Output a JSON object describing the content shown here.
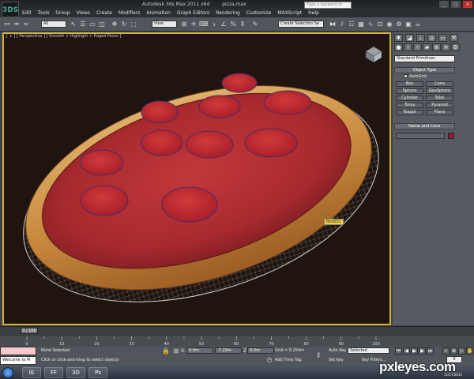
{
  "window": {
    "app_title": "Autodesk 3ds Max 2011 x64",
    "file_name": "pizza.max",
    "search_placeholder": "Type a keyword or phrase",
    "logo": "3DS",
    "controls": [
      "_",
      "□",
      "x"
    ]
  },
  "menu": [
    "Edit",
    "Tools",
    "Group",
    "Views",
    "Create",
    "Modifiers",
    "Animation",
    "Graph Editors",
    "Rendering",
    "Customize",
    "MAXScript",
    "Help"
  ],
  "toolbar": {
    "filter_value": "All",
    "refcoord_value": "View",
    "named_sel_placeholder": "Create Selection Se"
  },
  "viewport": {
    "label": "[ + ] [ Perspective ] [ Smooth + Highlight + Edged Faces ]",
    "object_tag": "Box001"
  },
  "command_panel": {
    "category_value": "Standard Primitives",
    "object_type_title": "Object Type",
    "autogrid_label": "AutoGrid",
    "buttons": [
      "Box",
      "Cone",
      "Sphere",
      "GeoSphere",
      "Cylinder",
      "Tube",
      "Torus",
      "Pyramid",
      "Teapot",
      "Plane"
    ],
    "name_color_title": "Name and Color",
    "object_color": "#9a1a3a"
  },
  "timeline": {
    "slider_label": "0 / 100",
    "ticks": [
      "0",
      "10",
      "20",
      "30",
      "40",
      "50",
      "60",
      "70",
      "80",
      "90",
      "100"
    ],
    "tick_values": [
      0,
      10,
      20,
      30,
      40,
      50,
      60,
      70,
      80,
      90,
      100
    ]
  },
  "status": {
    "maxscript_text": "Welcome to M",
    "selection_status": "None Selected",
    "prompt": "Click or click-and-drag to select objects",
    "x_label": "X:",
    "x_value": "0.0m",
    "y_label": "Y:",
    "y_value": "-7.22m",
    "z_label": "Z:",
    "z_value": "0.0m",
    "grid": "Grid = 0.254m",
    "add_time_tag": "Add Time Tag",
    "auto_key": "Auto Key",
    "set_key": "Set Key",
    "selected_value": "Selected",
    "key_filters": "Key Filters...",
    "frame_value": "0"
  },
  "taskbar": {
    "apps": [
      "IE",
      "FF",
      "3D",
      "Ps"
    ],
    "clock": "11/17/2011"
  },
  "watermark": "pxleyes.com"
}
